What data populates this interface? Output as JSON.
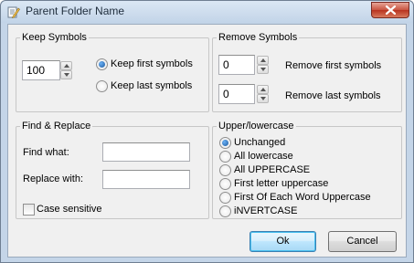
{
  "window": {
    "title": "Parent Folder Name"
  },
  "keep_symbols": {
    "title": "Keep Symbols",
    "value": "100",
    "options": [
      "Keep first symbols",
      "Keep last symbols"
    ],
    "selected": "Keep first symbols"
  },
  "remove_symbols": {
    "title": "Remove Symbols",
    "first_value": "0",
    "first_label": "Remove first symbols",
    "last_value": "0",
    "last_label": "Remove last symbols"
  },
  "find_replace": {
    "title": "Find & Replace",
    "find_label": "Find what:",
    "find_value": "",
    "replace_label": "Replace with:",
    "replace_value": "",
    "case_label": "Case sensitive",
    "case_checked": false
  },
  "case_group": {
    "title": "Upper/lowercase",
    "options": [
      "Unchanged",
      "All lowercase",
      "All UPPERCASE",
      "First letter uppercase",
      "First Of Each Word Uppercase",
      "iNVERTCASE"
    ],
    "selected": "Unchanged"
  },
  "buttons": {
    "ok": "Ok",
    "cancel": "Cancel"
  },
  "colors": {
    "accent": "#1d5a9e",
    "frame": "#c4d5e8",
    "client": "#f0f0f0"
  }
}
